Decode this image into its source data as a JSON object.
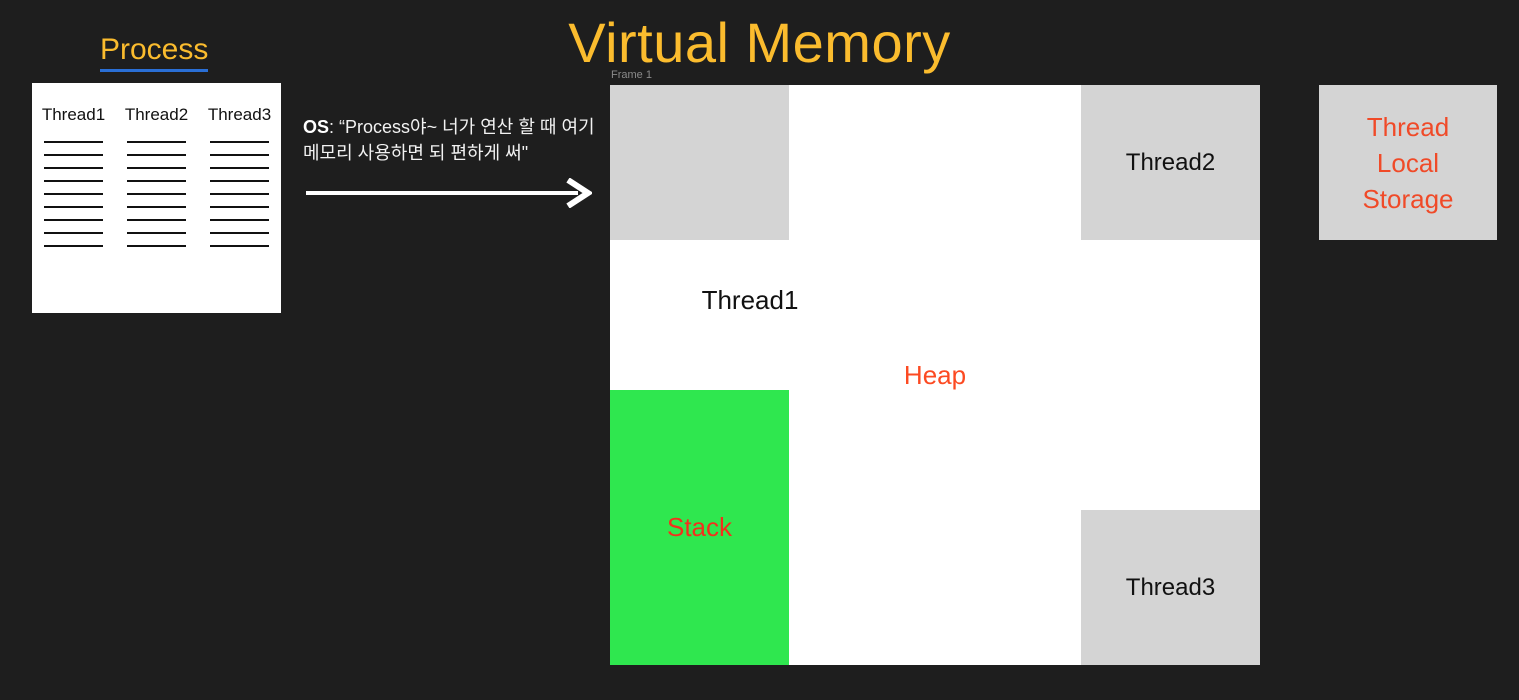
{
  "slide": {
    "background_color": "#1e1e1e",
    "title": "Virtual Memory",
    "title_color": "#fbbc2e"
  },
  "process": {
    "heading": "Process",
    "heading_color": "#fbbc2e",
    "underline_color": "#2a6fd6",
    "box_color": "#ffffff",
    "columns": [
      {
        "label": "Thread1",
        "line_count": 9
      },
      {
        "label": "Thread2",
        "line_count": 9
      },
      {
        "label": "Thread3",
        "line_count": 9
      }
    ]
  },
  "os_message": {
    "label": "OS",
    "separator": ": ",
    "text": "“Process야~ 너가 연산 할 때 여기 메모리 사용하면 되 편하게 써\"",
    "arrow_icon": "right-arrow-icon",
    "arrow_color": "#ffffff"
  },
  "virtual_memory": {
    "frame_label": "Frame 1",
    "frame_label_color": "#8a8a8a",
    "frame_color": "#ffffff",
    "block_color": "#d4d4d4",
    "blocks": [
      {
        "name": "top-left-block",
        "label": ""
      },
      {
        "name": "thread2-block",
        "label": "Thread2"
      },
      {
        "name": "thread3-block",
        "label": "Thread3"
      }
    ],
    "stack": {
      "label": "Stack",
      "fill_color": "#2fe74f",
      "text_color": "#f3301d"
    },
    "heap": {
      "label": "Heap",
      "text_color": "#fc4a22"
    },
    "thread1": {
      "label": "Thread1",
      "text_color": "#111111"
    }
  },
  "thread_local_storage": {
    "lines": [
      "Thread",
      "Local",
      "Storage"
    ],
    "box_color": "#d4d4d4",
    "text_color": "#f04a28"
  }
}
